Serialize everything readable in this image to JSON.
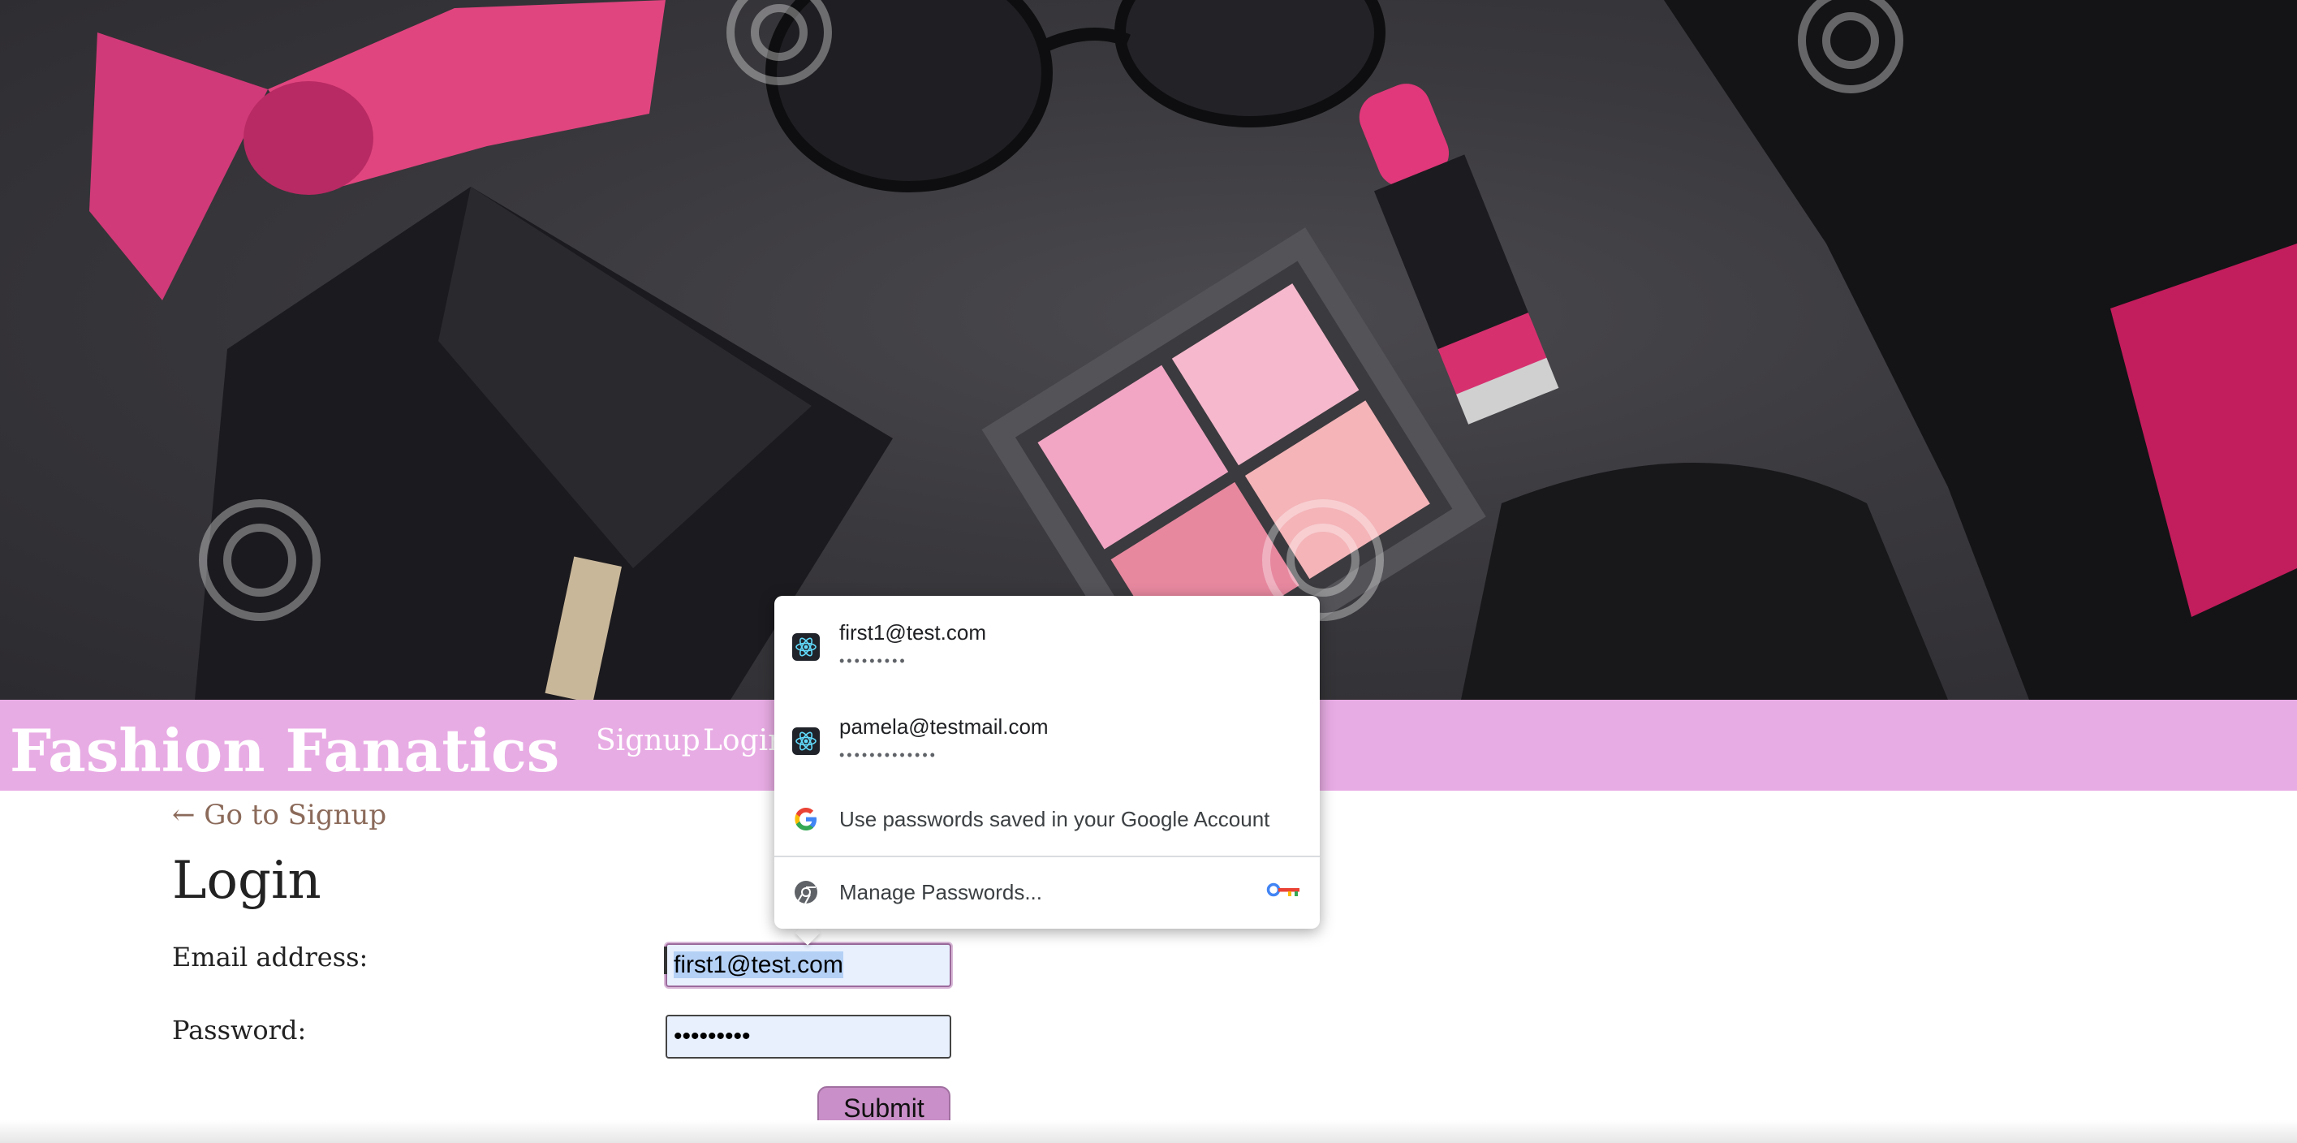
{
  "nav": {
    "brand": "Fashion Fanatics",
    "links": [
      "Signup",
      "Login"
    ]
  },
  "page": {
    "back_link": "← Go to Signup",
    "title": "Login",
    "email_label": "Email address:",
    "password_label": "Password:",
    "email_value": "first1@test.com",
    "password_value": "•••••••••",
    "submit_label": "Submit"
  },
  "autofill": {
    "credentials": [
      {
        "email": "first1@test.com",
        "password_mask": "•••••••••"
      },
      {
        "email": "pamela@testmail.com",
        "password_mask": "•••••••••••••"
      }
    ],
    "google_option": "Use passwords saved in your Google Account",
    "manage_option": "Manage Passwords..."
  },
  "colors": {
    "navbar": "#e8ace4",
    "submit": "#c98fc8",
    "back_link": "#8b6a5a"
  },
  "icons": {
    "credential": "react-atom-icon",
    "google": "google-g-icon",
    "manage": "chrome-icon",
    "key": "key-icon"
  }
}
